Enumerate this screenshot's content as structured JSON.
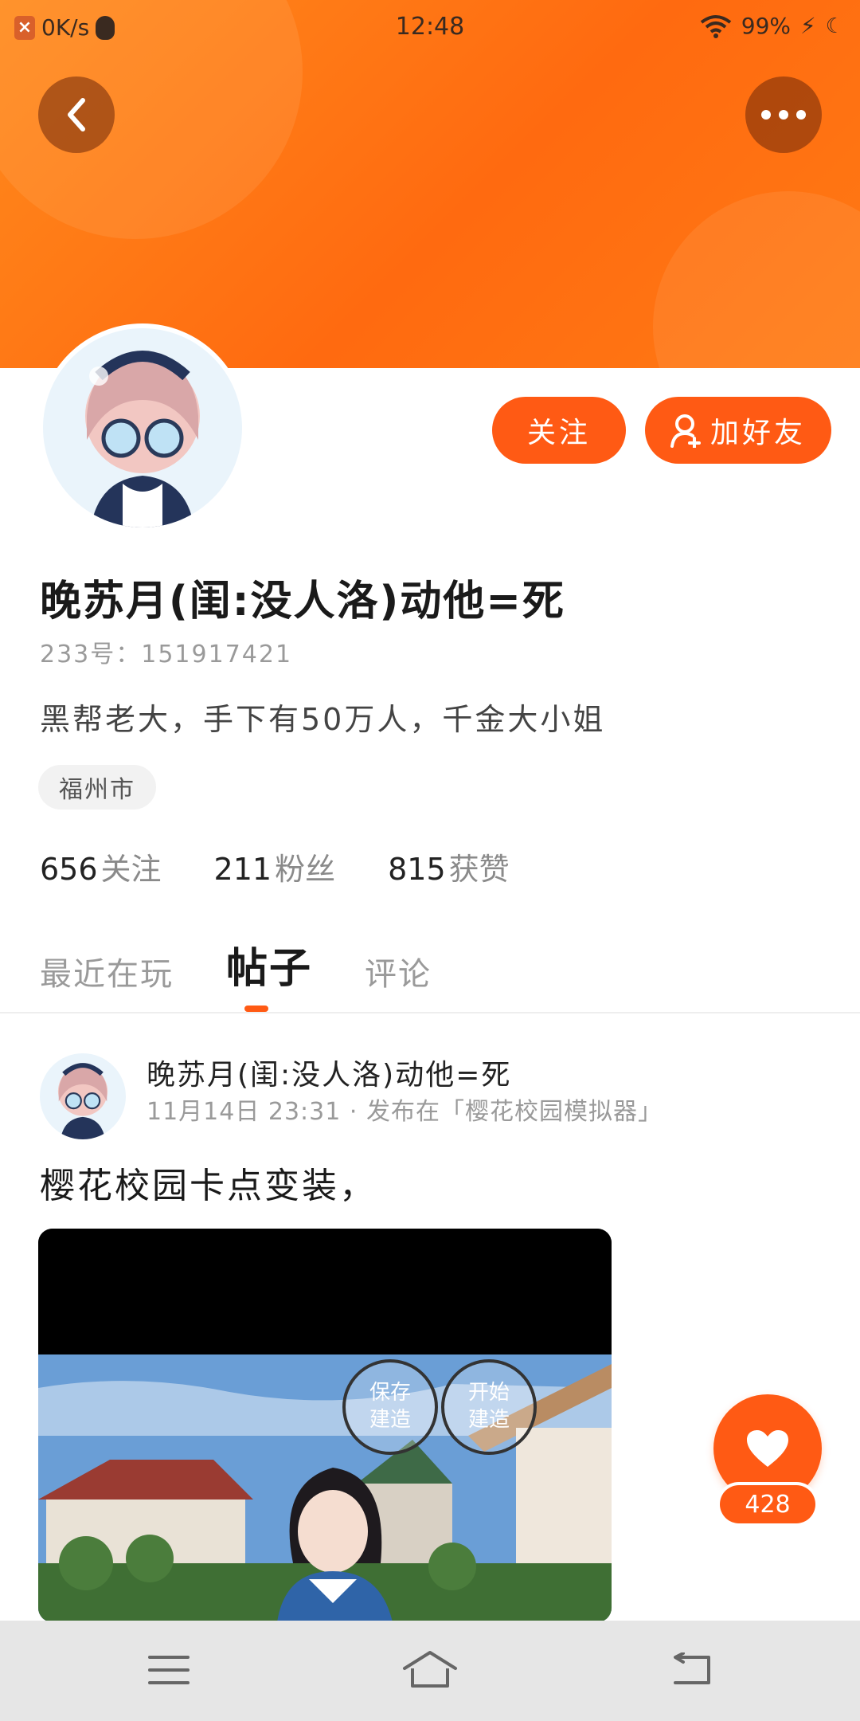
{
  "status_bar": {
    "net_speed": "0K/s",
    "time": "12:48",
    "battery": "99%"
  },
  "profile": {
    "name": "晚苏月(闺:没人洛)动他=死",
    "uid": "233号：151917421",
    "bio": "黑帮老大，手下有50万人，千金大小姐",
    "location": "福州市",
    "follow_button": "关注",
    "add_friend_button": "加好友",
    "stats": [
      {
        "num": "656",
        "label": "关注"
      },
      {
        "num": "211",
        "label": "粉丝"
      },
      {
        "num": "815",
        "label": "获赞"
      }
    ]
  },
  "tabs": [
    {
      "label": "最近在玩"
    },
    {
      "label": "帖子"
    },
    {
      "label": "评论"
    }
  ],
  "post": {
    "author": "晚苏月(闺:没人洛)动他=死",
    "meta": "11月14日 23:31 · 发布在「樱花校园模拟器」",
    "text": "樱花校园卡点变装，",
    "image_buttons": [
      "保存\n建造",
      "开始\n建造"
    ]
  },
  "like": {
    "count": "428"
  },
  "colors": {
    "accent": "#ff5a14",
    "banner": "#ff7a14"
  },
  "icons": {
    "back": "back-arrow-icon",
    "more": "more-dots-icon",
    "add_friend": "add-user-icon",
    "like": "heart-icon",
    "nav": [
      "menu-icon",
      "home-icon",
      "back-icon"
    ]
  }
}
